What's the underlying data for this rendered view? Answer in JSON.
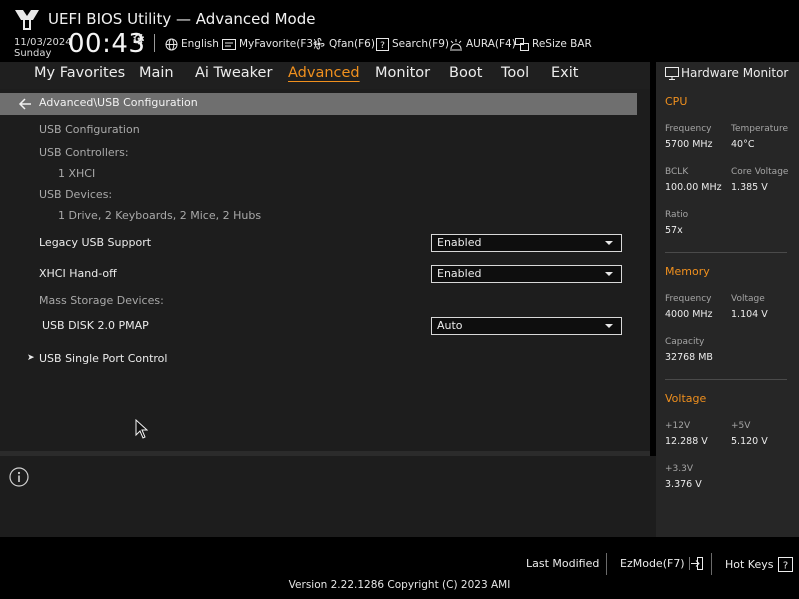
{
  "header": {
    "title": "UEFI BIOS Utility — Advanced Mode",
    "date": "11/03/2024",
    "day": "Sunday",
    "time": "00:43",
    "tools": [
      {
        "icon": "globe-icon",
        "label": "English"
      },
      {
        "icon": "my-favorite-icon",
        "label": "MyFavorite(F3)"
      },
      {
        "icon": "fan-icon",
        "label": "Qfan(F6)"
      },
      {
        "icon": "search-icon",
        "label": "Search(F9)"
      },
      {
        "icon": "aura-icon",
        "label": "AURA(F4)"
      },
      {
        "icon": "resize-bar-icon",
        "label": "ReSize BAR"
      }
    ]
  },
  "menu": {
    "items": [
      "My Favorites",
      "Main",
      "Ai Tweaker",
      "Advanced",
      "Monitor",
      "Boot",
      "Tool",
      "Exit"
    ],
    "active": "Advanced"
  },
  "breadcrumb": "Advanced\\USB Configuration",
  "settings": {
    "usb_configuration": "USB Configuration",
    "usb_controllers_label": "USB Controllers:",
    "usb_controllers_value": "1 XHCI",
    "usb_devices_label": "USB Devices:",
    "usb_devices_value": "1 Drive, 2 Keyboards, 2 Mice, 2 Hubs",
    "legacy_usb_support": {
      "label": "Legacy USB Support",
      "value": "Enabled"
    },
    "xhci_handoff": {
      "label": "XHCI Hand-off",
      "value": "Enabled"
    },
    "mass_storage_label": "Mass Storage Devices:",
    "usb_disk": {
      "label": "USB DISK 2.0 PMAP",
      "value": "Auto"
    },
    "usb_single_port_control": "USB Single Port Control"
  },
  "hardware_monitor": {
    "title": "Hardware Monitor",
    "cpu": {
      "section": "CPU",
      "frequency_label": "Frequency",
      "frequency": "5700 MHz",
      "temperature_label": "Temperature",
      "temperature": "40°C",
      "bclk_label": "BCLK",
      "bclk": "100.00 MHz",
      "core_voltage_label": "Core Voltage",
      "core_voltage": "1.385 V",
      "ratio_label": "Ratio",
      "ratio": "57x"
    },
    "memory": {
      "section": "Memory",
      "frequency_label": "Frequency",
      "frequency": "4000 MHz",
      "voltage_label": "Voltage",
      "voltage": "1.104 V",
      "capacity_label": "Capacity",
      "capacity": "32768 MB"
    },
    "voltage": {
      "section": "Voltage",
      "v12_label": "+12V",
      "v12": "12.288 V",
      "v5_label": "+5V",
      "v5": "5.120 V",
      "v33_label": "+3.3V",
      "v33": "3.376 V"
    }
  },
  "footer": {
    "last_modified": "Last Modified",
    "ezmode": "EzMode(F7)",
    "hotkeys": "Hot Keys",
    "version": "Version 2.22.1286 Copyright (C) 2023 AMI"
  },
  "colors": {
    "accent": "#f0901e",
    "background": "#1d1d1d",
    "breadcrumb_bar": "#6f6f6f",
    "hw_panel": "#262626"
  }
}
